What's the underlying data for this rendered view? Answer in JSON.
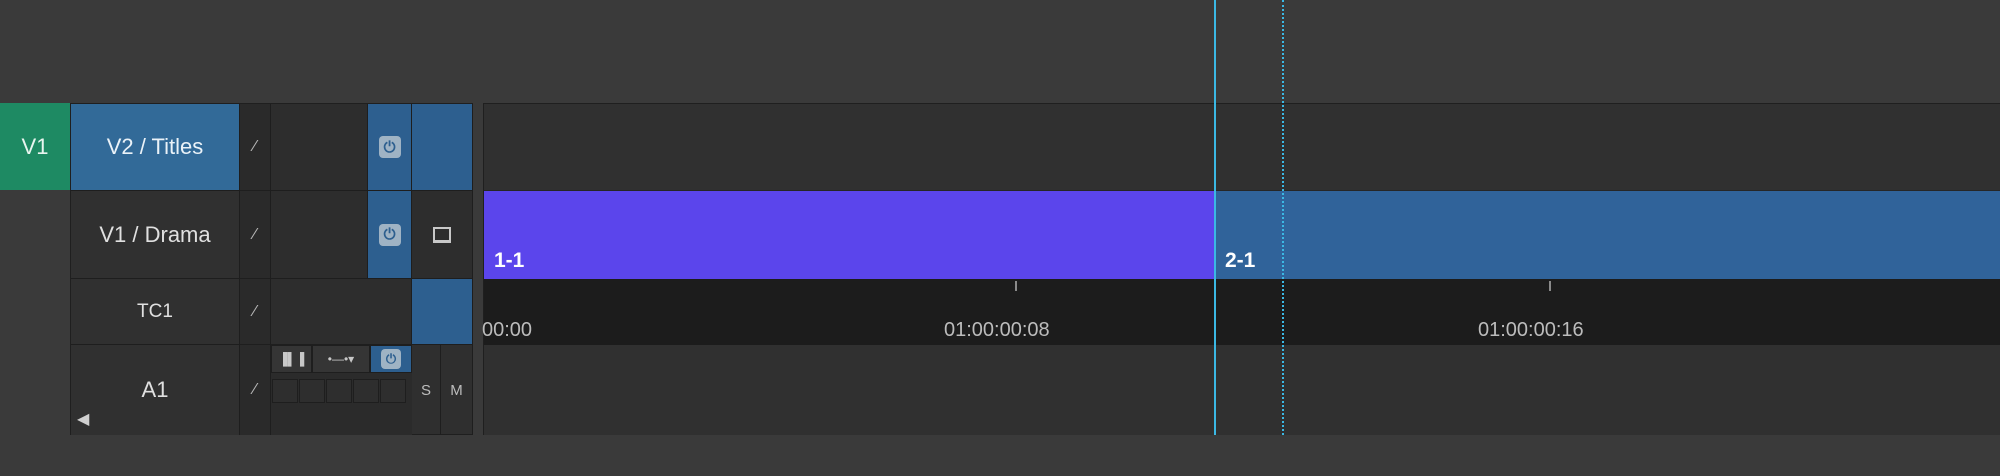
{
  "source_patch": {
    "label": "V1"
  },
  "tracks": [
    {
      "name": "V2 / Titles"
    },
    {
      "name": "V1 / Drama"
    },
    {
      "name": "TC1"
    },
    {
      "name": "A1"
    }
  ],
  "audio_controls": {
    "solo": "S",
    "mute": "M"
  },
  "clips": [
    {
      "label": "1-1",
      "color": "#5b45ec"
    },
    {
      "label": "2-1",
      "color": "#30639a"
    }
  ],
  "timecodes": [
    "00:00",
    "01:00:00:08",
    "01:00:00:16"
  ],
  "colors": {
    "accent": "#326a98",
    "playhead": "#3bb8e4",
    "record": "#1e8a63"
  }
}
